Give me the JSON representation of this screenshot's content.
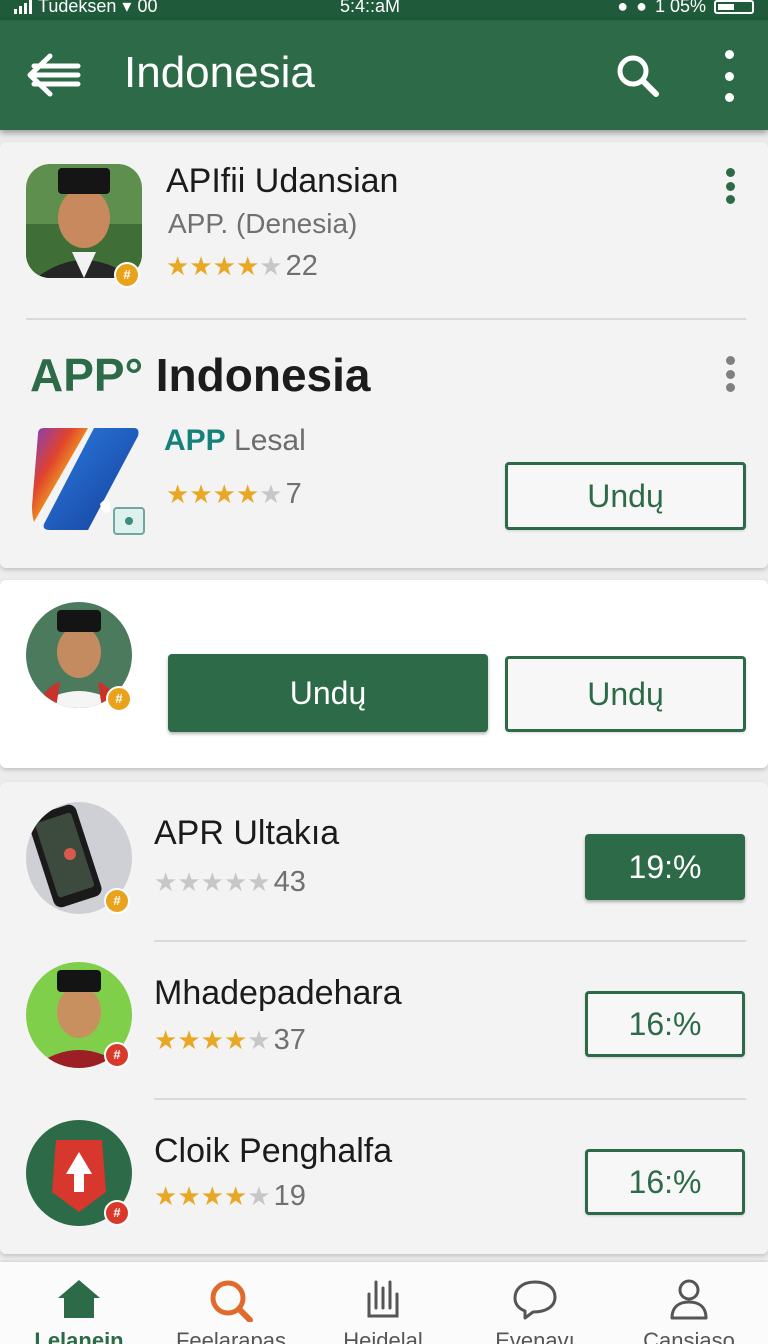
{
  "status_bar": {
    "carrier": "Tudeksen",
    "signal_extra": "00",
    "time": "5:4::aM",
    "battery": "1 05%"
  },
  "app_bar": {
    "title": "Indonesia"
  },
  "featured": {
    "name": "APIfii Udansian",
    "developer": "APP. (Denesia)",
    "rating": 3.5,
    "reviews": "22"
  },
  "section": {
    "title_accent": "APP°",
    "title_rest": " Indonesia",
    "app_publisher_bold": "APP",
    "app_publisher_rest": " Lesal",
    "rating": 3.5,
    "reviews": "7",
    "install_label": "Undų"
  },
  "promo": {
    "primary_button": "Undų",
    "secondary_button": "Undų"
  },
  "list": [
    {
      "name": "APR Ultakıa",
      "rating": 0,
      "reviews": "43",
      "action": "19:%",
      "action_style": "solid",
      "badge_color": "#e9a21c"
    },
    {
      "name": "Mhadepadehara",
      "rating": 3.5,
      "reviews": "37",
      "action": "16:%",
      "action_style": "outline",
      "badge_color": "#d8392b"
    },
    {
      "name": "Cloik Penghalfa",
      "rating": 3.5,
      "reviews": "19",
      "action": "16:%",
      "action_style": "outline",
      "badge_color": "#d8392b"
    }
  ],
  "bottom_nav": [
    {
      "label": "Lelanein",
      "icon": "home-icon",
      "active": true
    },
    {
      "label": "Feelarapas",
      "icon": "search-icon",
      "active": false
    },
    {
      "label": "Heidelal",
      "icon": "grid-icon",
      "active": false
    },
    {
      "label": "Evenavı",
      "icon": "chat-icon",
      "active": false
    },
    {
      "label": "Cansiaso",
      "icon": "person-icon",
      "active": false
    }
  ],
  "colors": {
    "primary": "#2d6b48",
    "star": "#e8a826",
    "accent_orange": "#e06a2c",
    "teal": "#15827a"
  }
}
